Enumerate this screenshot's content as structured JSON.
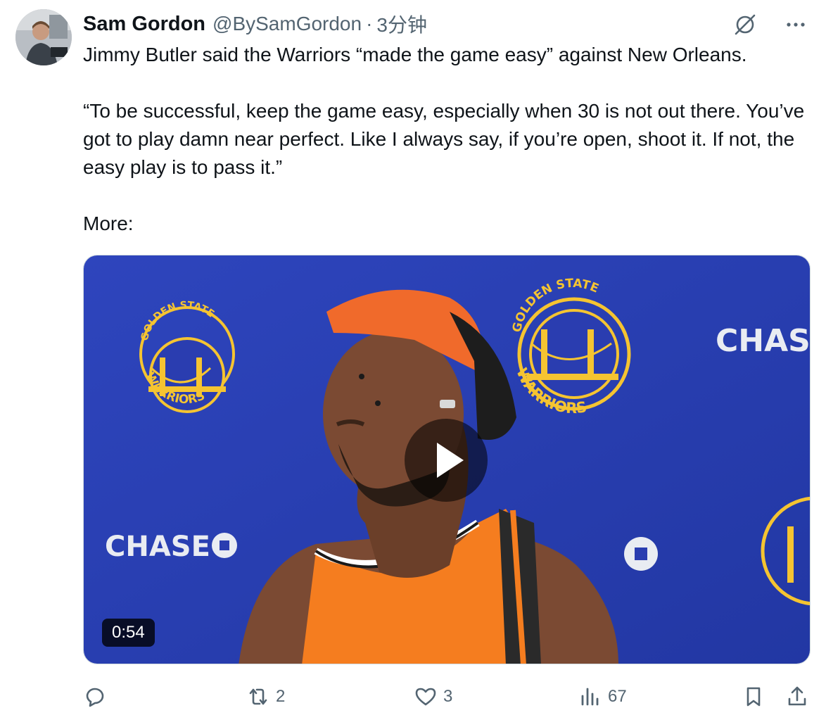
{
  "author": {
    "name": "Sam Gordon",
    "handle": "@BySamGordon",
    "separator": "·",
    "time": "3分钟"
  },
  "tweet": {
    "line1": "Jimmy Butler said the Warriors “made the game easy” against New Orleans.",
    "quote": "“To be successful, keep the game easy, especially when 30 is not out there. You’ve got to play damn near perfect. Like I always say, if you’re open, shoot it. If not, the easy play is to pass it.”",
    "line3": "More:"
  },
  "video": {
    "duration": "0:54",
    "backdrop_text": {
      "team_top": "GOLDEN STATE",
      "team_bottom": "WARRIORS",
      "sponsor": "CHASE"
    }
  },
  "actions": {
    "reply_count": "",
    "repost_count": "2",
    "like_count": "3",
    "views_count": "67"
  },
  "icons": [
    "grok-icon",
    "more-icon",
    "reply-icon",
    "repost-icon",
    "like-icon",
    "views-icon",
    "bookmark-icon",
    "share-icon",
    "play-icon"
  ],
  "colors": {
    "text": "#0f1419",
    "secondary": "#536471",
    "backdrop_blue": "#2b3fb3",
    "warriors_gold": "#f5c431",
    "jersey_orange": "#f57d1f"
  }
}
